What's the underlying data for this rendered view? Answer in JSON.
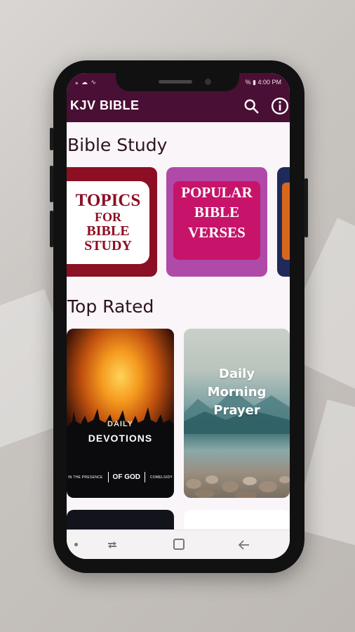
{
  "status_bar": {
    "left_icons": "⁎ ☁ ∿",
    "right": "% ▮ 4:00 PM"
  },
  "app_bar": {
    "title": "KJV BIBLE",
    "icons": [
      "search-icon",
      "info-icon"
    ]
  },
  "sections": {
    "bible_study": {
      "title": "Bible Study",
      "cards": [
        {
          "lines": [
            "TOPICS",
            "FOR",
            "BIBLE",
            "STUDY"
          ]
        },
        {
          "lines": [
            "POPULAR",
            "BIBLE",
            "VERSES"
          ]
        }
      ]
    },
    "top_rated": {
      "title": "Top Rated",
      "cards": [
        {
          "kicker": "DAILY",
          "title": "DEVOTIONS",
          "footer_left": "IN THE PRESENCE",
          "footer_mid": "OF GOD",
          "footer_right": "COMELSIDY"
        },
        {
          "lines": [
            "Daily",
            "Morning",
            "Prayer"
          ]
        }
      ]
    }
  },
  "nav_bar": {
    "icons": [
      "dot-icon",
      "recent-apps-icon",
      "home-icon",
      "back-icon"
    ]
  },
  "colors": {
    "app_bar": "#4a0f34",
    "topics_red": "#8c0f23",
    "popular_purple": "#b04aa8",
    "popular_pink": "#c7146a"
  }
}
